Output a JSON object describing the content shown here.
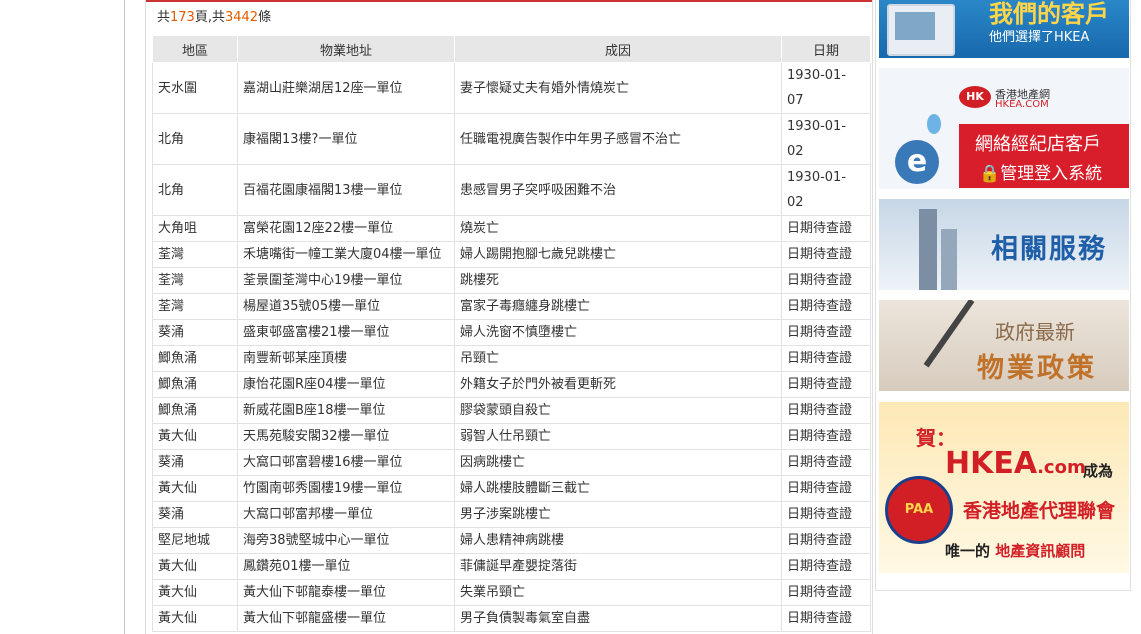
{
  "summary": {
    "prefix": "共",
    "pages": "173",
    "mid": "頁,共",
    "count": "3442",
    "suffix": "條"
  },
  "table": {
    "headers": [
      "地區",
      "物業地址",
      "成因",
      "日期"
    ],
    "rows": [
      {
        "district": "天水圍",
        "address": "嘉湖山莊樂湖居12座一單位",
        "cause": "妻子懷疑丈夫有婚外情燒炭亡",
        "date": "1930-01-07"
      },
      {
        "district": "北角",
        "address": "康福閣13樓?一單位",
        "cause": "任職電視廣告製作中年男子感冒不治亡",
        "date": "1930-01-02"
      },
      {
        "district": "北角",
        "address": "百福花園康福閣13樓一單位",
        "cause": "患感冒男子突呼吸困難不治",
        "date": "1930-01-02"
      },
      {
        "district": "大角咀",
        "address": "富榮花園12座22樓一單位",
        "cause": "燒炭亡",
        "date": "日期待查證"
      },
      {
        "district": "荃灣",
        "address": "禾塘嘴街一幢工業大廈04樓一單位",
        "cause": "婦人踢開抱腳七歲兒跳樓亡",
        "date": "日期待查證"
      },
      {
        "district": "荃灣",
        "address": "荃景圍荃灣中心19樓一單位",
        "cause": "跳樓死",
        "date": "日期待查證"
      },
      {
        "district": "荃灣",
        "address": "楊屋道35號05樓一單位",
        "cause": "富家子毒癮纏身跳樓亡",
        "date": "日期待查證"
      },
      {
        "district": "葵涌",
        "address": "盛東邨盛富樓21樓一單位",
        "cause": "婦人洗窗不慎墮樓亡",
        "date": "日期待查證"
      },
      {
        "district": "鯽魚涌",
        "address": "南豐新邨某座頂樓",
        "cause": "吊頸亡",
        "date": "日期待查證"
      },
      {
        "district": "鯽魚涌",
        "address": "康怡花園R座04樓一單位",
        "cause": "外籍女子於門外被看更斬死",
        "date": "日期待查證"
      },
      {
        "district": "鯽魚涌",
        "address": "新威花園B座18樓一單位",
        "cause": "膠袋蒙頭自殺亡",
        "date": "日期待查證"
      },
      {
        "district": "黃大仙",
        "address": "天馬苑駿安閣32樓一單位",
        "cause": "弱智人仕吊頸亡",
        "date": "日期待查證"
      },
      {
        "district": "葵涌",
        "address": "大窩口邨富碧樓16樓一單位",
        "cause": "因病跳樓亡",
        "date": "日期待查證"
      },
      {
        "district": "黃大仙",
        "address": "竹園南邨秀園樓19樓一單位",
        "cause": "婦人跳樓肢體斷三截亡",
        "date": "日期待查證"
      },
      {
        "district": "葵涌",
        "address": "大窩口邨富邦樓一單位",
        "cause": "男子涉案跳樓亡",
        "date": "日期待查證"
      },
      {
        "district": "堅尼地城",
        "address": "海旁38號堅城中心一單位",
        "cause": "婦人患精神病跳樓",
        "date": "日期待查證"
      },
      {
        "district": "黃大仙",
        "address": "鳳鑽苑01樓一單位",
        "cause": "菲傭誕早產嬰掟落街",
        "date": "日期待查證"
      },
      {
        "district": "黃大仙",
        "address": "黃大仙下邨龍泰樓一單位",
        "cause": "失業吊頸亡",
        "date": "日期待查證"
      },
      {
        "district": "黃大仙",
        "address": "黃大仙下邨龍盛樓一單位",
        "cause": "男子負債製毒氣室自盡",
        "date": "日期待查證"
      }
    ]
  },
  "banners": {
    "clients": {
      "title": "我們的客戶",
      "subtitle": "他們選擇了HKEA"
    },
    "agent_login": {
      "logo": "HK",
      "logo_cn": "香港地產網",
      "logo_en": "HKEA.COM",
      "line1": "網絡經紀店客戶",
      "line2": "🔒管理登入系統"
    },
    "services": {
      "title": "相關服務"
    },
    "policy": {
      "line1": "政府最新",
      "line2": "物業政策"
    },
    "congrats": {
      "he": "賀：",
      "brand": "HKEA",
      "brand_suffix": ".com",
      "cheng": "成為",
      "org": "香港地產代理聯會",
      "only_a": "唯一的",
      "only_b": "地產資訊顧問",
      "emblem": "PAA"
    }
  },
  "colors": {
    "accent_red": "#cc3333",
    "number_orange": "#e05b00",
    "header_gray": "#e7e7e7"
  }
}
